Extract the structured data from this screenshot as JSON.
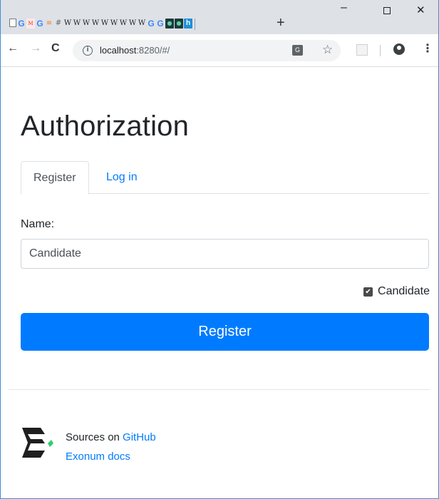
{
  "browser": {
    "tab_favicons": [
      "doc-icon",
      "google-icon",
      "gmail-icon",
      "google-icon",
      "stackoverflow-icon",
      "hash-icon",
      "wiki-icon",
      "wiki-icon",
      "wiki-icon",
      "wiki-icon",
      "wiki-icon",
      "wiki-icon",
      "wiki-icon",
      "wiki-icon",
      "wiki-icon",
      "google-icon",
      "google-icon",
      "app-icon",
      "app-icon",
      "h-icon"
    ],
    "new_tab_label": "+",
    "window_controls": {
      "minimize": "–",
      "close": "✕"
    },
    "address": {
      "host": "localhost",
      "rest": ":8280/#/"
    },
    "info_glyph": "i",
    "translate_glyph": "G",
    "star_glyph": "☆",
    "menu_glyph": "⋮"
  },
  "page": {
    "title": "Authorization",
    "tabs": [
      {
        "label": "Register",
        "active": true
      },
      {
        "label": "Log in",
        "active": false
      }
    ],
    "name_label": "Name:",
    "name_value": "Candidate",
    "checkbox": {
      "label": "Candidate",
      "checked": true
    },
    "submit_label": "Register"
  },
  "footer": {
    "sources_prefix": "Sources on ",
    "github_link": "GitHub",
    "docs_link": "Exonum docs"
  },
  "colors": {
    "primary": "#007bff",
    "text": "#212529",
    "tab_border": "#dee2e6",
    "logo_dark": "#1f1f1f",
    "logo_green": "#2ecc71"
  }
}
